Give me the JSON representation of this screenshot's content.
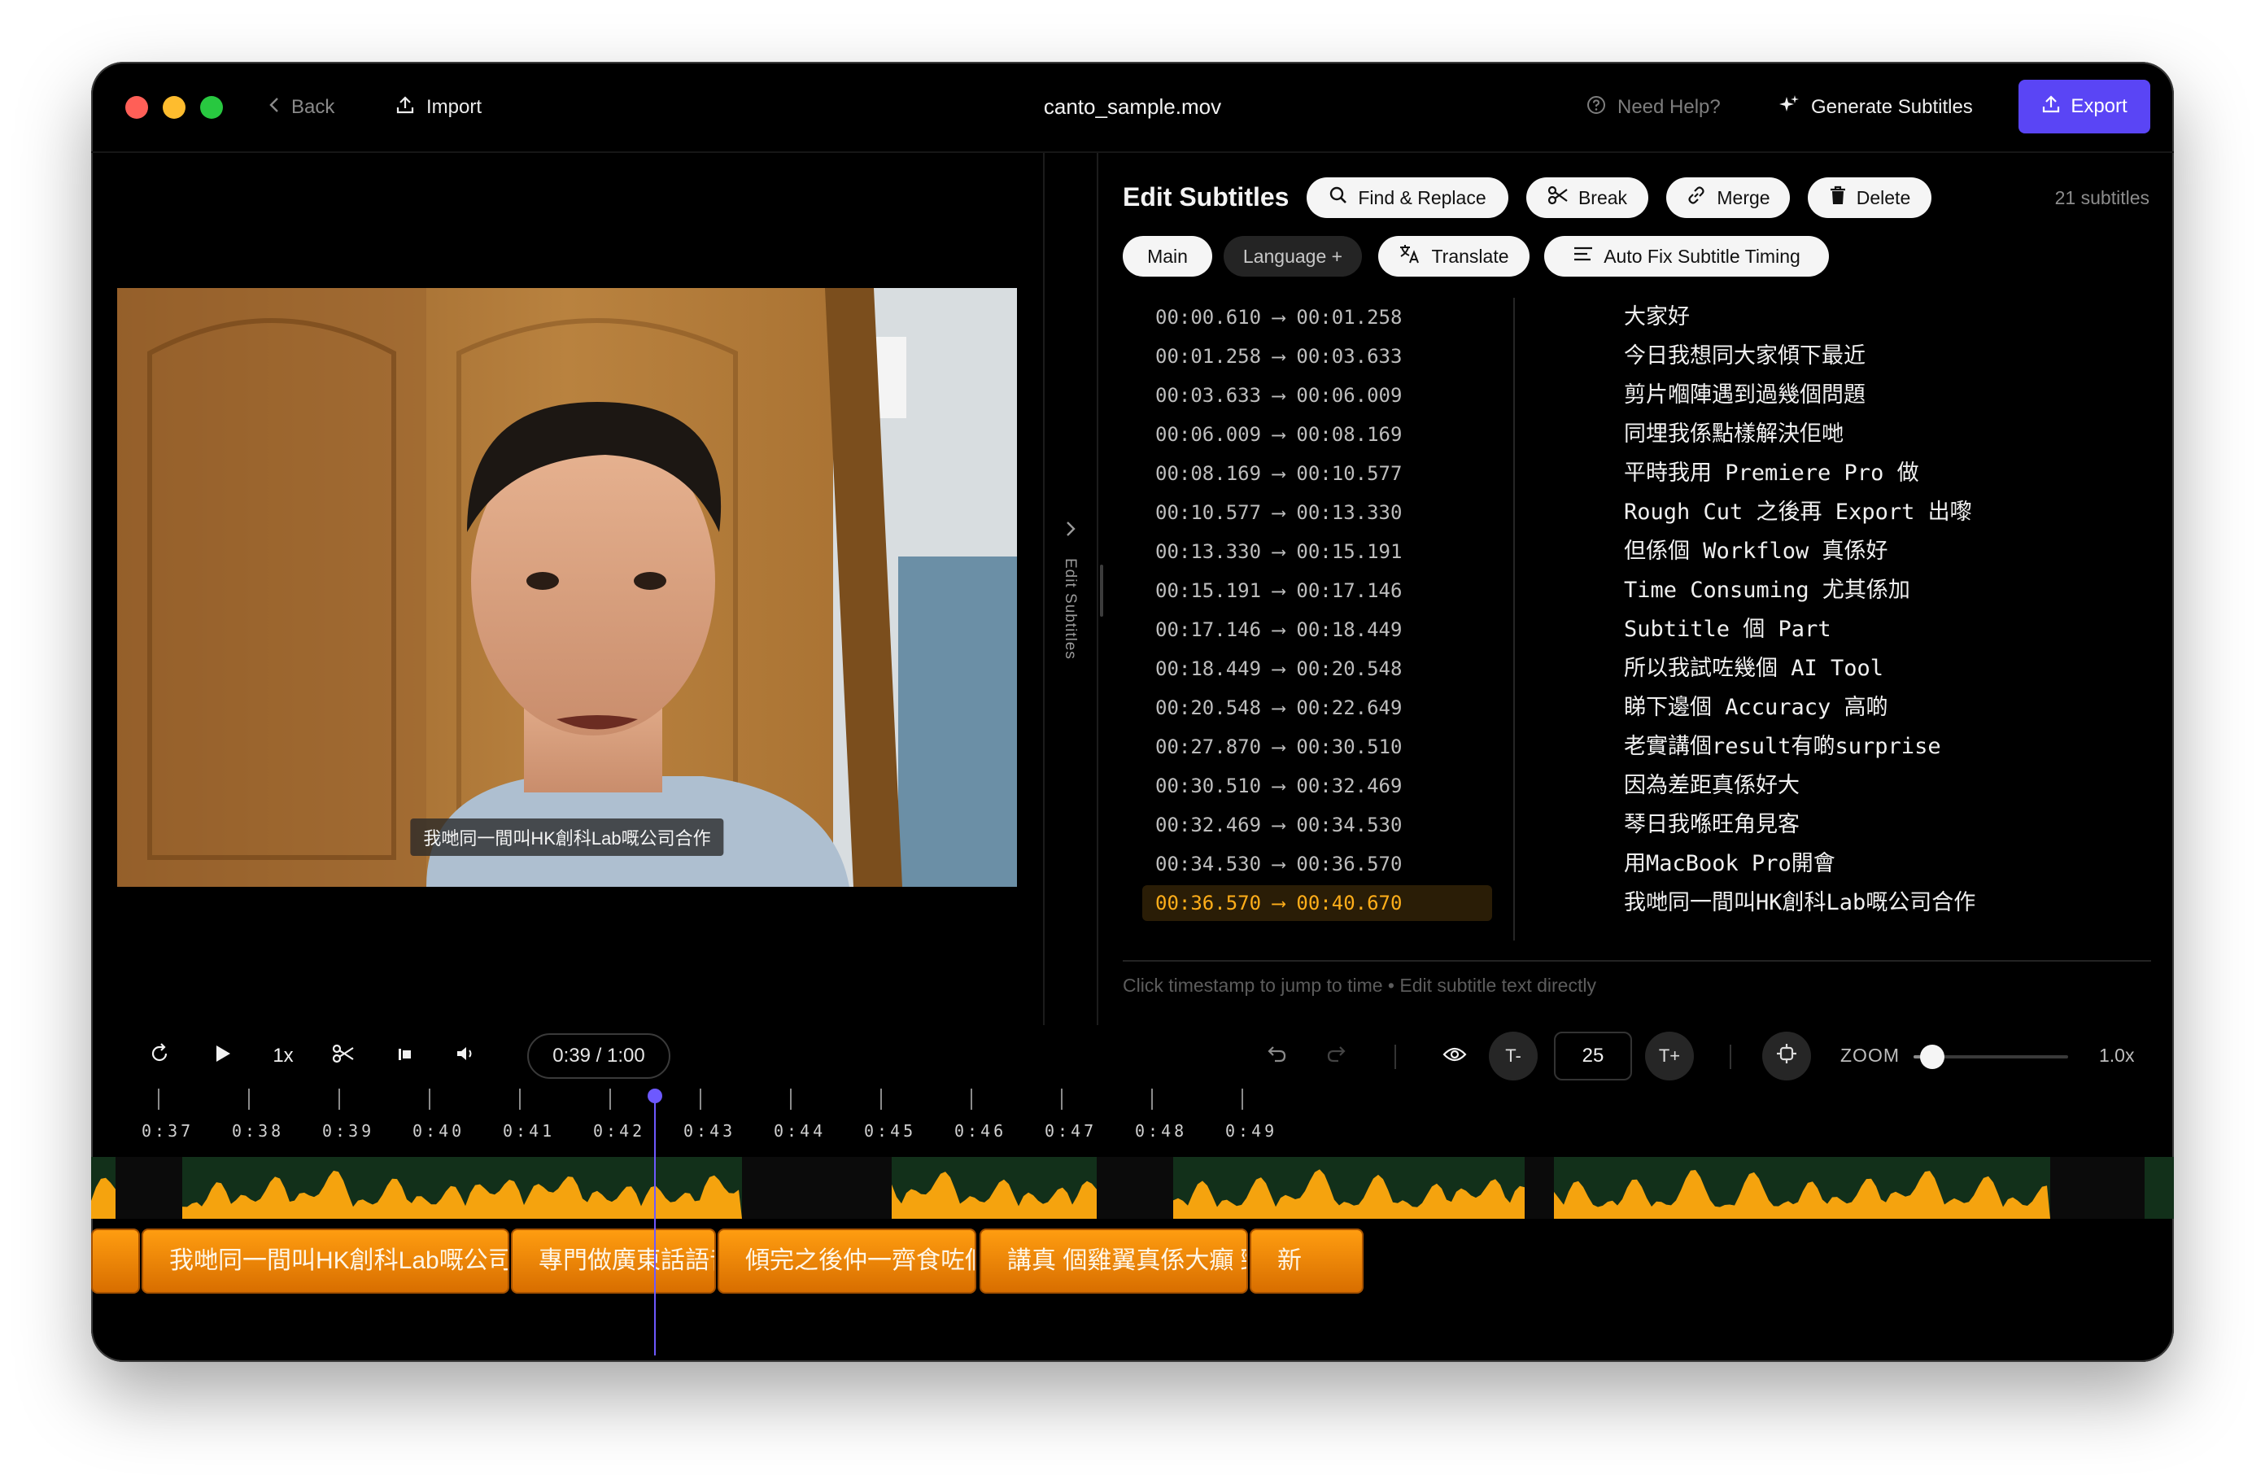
{
  "titlebar": {
    "back_label": "Back",
    "import_label": "Import",
    "file_name": "canto_sample.mov",
    "help_label": "Need Help?",
    "generate_label": "Generate Subtitles",
    "export_label": "Export"
  },
  "video": {
    "caption": "我哋同一間叫HK創科Lab嘅公司合作",
    "side_tab_label": "Edit Subtitles"
  },
  "panel": {
    "title": "Edit Subtitles",
    "find_replace_label": "Find & Replace",
    "break_label": "Break",
    "merge_label": "Merge",
    "delete_label": "Delete",
    "subtitle_count": "21 subtitles",
    "main_tab": "Main",
    "language_tab": "Language +",
    "translate_label": "Translate",
    "auto_fix_label": "Auto Fix Subtitle Timing",
    "hint": "Click timestamp to jump to time • Edit subtitle text directly",
    "active_index": 15,
    "subtitles": [
      {
        "start": "00:00.610",
        "end": "00:01.258",
        "text": "大家好"
      },
      {
        "start": "00:01.258",
        "end": "00:03.633",
        "text": "今日我想同大家傾下最近"
      },
      {
        "start": "00:03.633",
        "end": "00:06.009",
        "text": "剪片嗰陣遇到過幾個問題"
      },
      {
        "start": "00:06.009",
        "end": "00:08.169",
        "text": "同埋我係點樣解決佢哋"
      },
      {
        "start": "00:08.169",
        "end": "00:10.577",
        "text": "平時我用 Premiere Pro 做"
      },
      {
        "start": "00:10.577",
        "end": "00:13.330",
        "text": "Rough Cut 之後再 Export 出嚟"
      },
      {
        "start": "00:13.330",
        "end": "00:15.191",
        "text": "但係個 Workflow 真係好"
      },
      {
        "start": "00:15.191",
        "end": "00:17.146",
        "text": "Time Consuming 尤其係加"
      },
      {
        "start": "00:17.146",
        "end": "00:18.449",
        "text": "Subtitle 個 Part"
      },
      {
        "start": "00:18.449",
        "end": "00:20.548",
        "text": "所以我試咗幾個 AI Tool"
      },
      {
        "start": "00:20.548",
        "end": "00:22.649",
        "text": "睇下邊個 Accuracy 高啲"
      },
      {
        "start": "00:27.870",
        "end": "00:30.510",
        "text": "老實講個result有啲surprise"
      },
      {
        "start": "00:30.510",
        "end": "00:32.469",
        "text": "因為差距真係好大"
      },
      {
        "start": "00:32.469",
        "end": "00:34.530",
        "text": "琴日我喺旺角見客"
      },
      {
        "start": "00:34.530",
        "end": "00:36.570",
        "text": "用MacBook Pro開會"
      },
      {
        "start": "00:36.570",
        "end": "00:40.670",
        "text": "我哋同一間叫HK創科Lab嘅公司合作"
      }
    ]
  },
  "controls": {
    "speed": "1x",
    "time_display": "0:39 / 1:00",
    "font_minus": "T-",
    "font_size": "25",
    "font_plus": "T+",
    "zoom_label": "ZOOM",
    "zoom_value": "1.0x",
    "zoom_level": 0.12
  },
  "timeline": {
    "ticks": [
      "0:37",
      "0:38",
      "0:39",
      "0:40",
      "0:41",
      "0:42",
      "0:43",
      "0:44",
      "0:45",
      "0:46",
      "0:47",
      "0:48",
      "0:49"
    ],
    "playhead_time": "0:39.8",
    "clips": [
      {
        "text": ""
      },
      {
        "text": "我哋同一間叫HK創科Lab嘅公司合作"
      },
      {
        "text": "專門做廣東話語音識別"
      },
      {
        "text": "傾完之後仲一齊食咗個 M 記"
      },
      {
        "text": "講真 個雞翼真係大癲 勁好食"
      },
      {
        "text": "新"
      }
    ]
  },
  "colors": {
    "accent": "#5a45f5",
    "active_time": "#ffae1a",
    "clip": "#ff9d10",
    "waveform": "#f5a30e",
    "waveform_bg": "#12301a"
  }
}
